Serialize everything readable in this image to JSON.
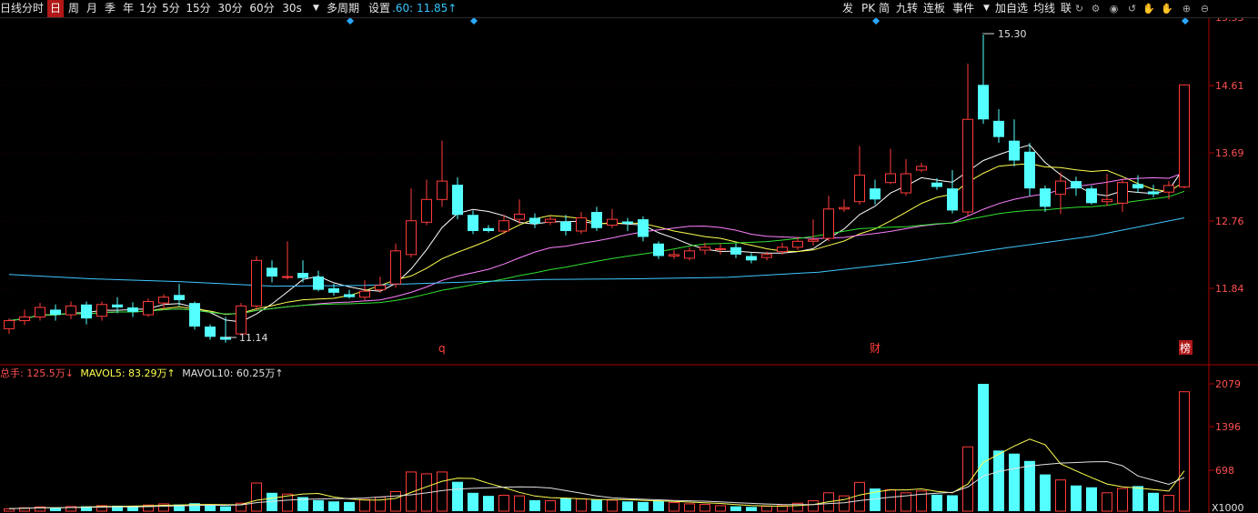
{
  "toolbar": {
    "left_items": [
      "日线",
      "分时",
      "日",
      "周",
      "月",
      "季",
      "年",
      "1分",
      "5分",
      "15分",
      "30分",
      "60分",
      "30s",
      "多周期",
      "设置"
    ],
    "ma_readout": ".60: 11.85↑",
    "right_items": [
      "发",
      "PK",
      "简",
      "九转",
      "连板",
      "事件",
      "加自选",
      "均线",
      "联"
    ]
  },
  "price_axis": {
    "ticks": [
      "15.53",
      "14.61",
      "13.69",
      "12.76",
      "11.84"
    ]
  },
  "annotations": {
    "high": "15.30",
    "low": "11.14",
    "marker_q": "q",
    "marker_cai": "财",
    "marker_bang": "榜"
  },
  "volume_panel": {
    "label_total": "总手: 125.5万↓",
    "label_mavol5": "MAVOL5: 83.29万↑",
    "label_mavol10": "MAVOL10: 60.25万↑",
    "ticks": [
      "2079",
      "1396",
      "698"
    ],
    "unit": "X1000"
  },
  "colors": {
    "up": "#ff3b3b",
    "down": "#54ffff",
    "ma5": "#ffffff",
    "ma10": "#ffff50",
    "ma20": "#ff80ff",
    "ma30": "#30e030",
    "ma60": "#40c8ff",
    "axis": "#aa0000"
  }
}
